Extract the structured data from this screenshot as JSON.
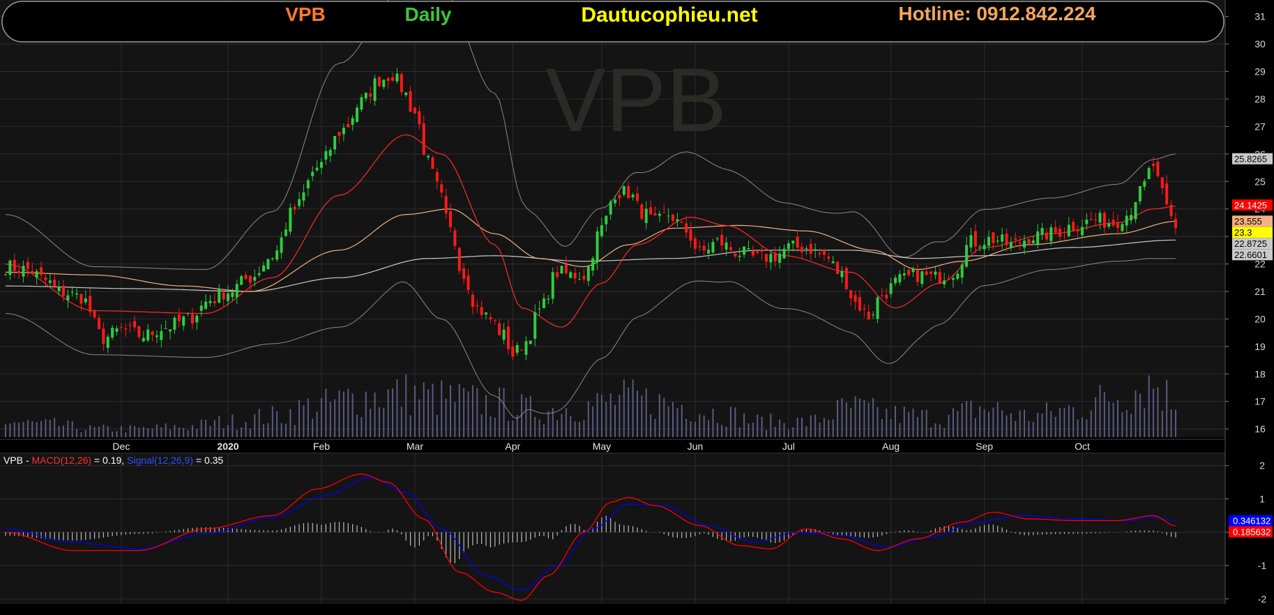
{
  "header": {
    "symbol": "VPB",
    "interval": "Daily",
    "site": "Dautucophieu.net",
    "hotline": "Hotline: 0912.842.224",
    "watermark": "VPB",
    "colors": {
      "symbol": "#ff7a2a",
      "interval": "#39c83a",
      "site": "#ffff00",
      "hotline": "#f5a65b"
    }
  },
  "price_axis": {
    "ticks": [
      "16",
      "17",
      "18",
      "19",
      "20",
      "21",
      "22",
      "23",
      "24",
      "25",
      "26",
      "27",
      "28",
      "29",
      "30",
      "31"
    ],
    "badges": [
      {
        "value": 25.8265,
        "text": "25.8265",
        "bg": "#c9c9c9",
        "fg": "#000000"
      },
      {
        "value": 24.1425,
        "text": "24.1425",
        "bg": "#ff0000",
        "fg": "#ffffff"
      },
      {
        "value": 23.555,
        "text": "23.555",
        "bg": "#f4b183",
        "fg": "#000000"
      },
      {
        "value": 23.3,
        "text": "23.3",
        "bg": "#ffff00",
        "fg": "#000000"
      },
      {
        "value": 22.8725,
        "text": "22.8725",
        "bg": "#c9c9c9",
        "fg": "#000000"
      },
      {
        "value": 22.6601,
        "text": "22.6601",
        "bg": "#c9c9c9",
        "fg": "#000000"
      }
    ]
  },
  "time_axis": {
    "labels": [
      {
        "text": "Dec",
        "bar": 26
      },
      {
        "text": "2020",
        "bar": 50,
        "bold": true
      },
      {
        "text": "Feb",
        "bar": 71
      },
      {
        "text": "Mar",
        "bar": 92
      },
      {
        "text": "Apr",
        "bar": 114
      },
      {
        "text": "May",
        "bar": 134
      },
      {
        "text": "Jun",
        "bar": 155
      },
      {
        "text": "Jul",
        "bar": 176
      },
      {
        "text": "Aug",
        "bar": 199
      },
      {
        "text": "Sep",
        "bar": 220
      },
      {
        "text": "Oct",
        "bar": 242
      }
    ]
  },
  "macd_panel": {
    "legend_symbol": "VPB - ",
    "macd_label": "MACD(12,26)",
    "macd_value": " = 0.19, ",
    "signal_label": "Signal(12,26,9)",
    "signal_value": " = 0.35",
    "ticks": [
      "-2",
      "-1",
      "0",
      "1",
      "2"
    ],
    "badges": [
      {
        "value": 0.3461,
        "text": "0.346132",
        "bg": "#0000ff",
        "fg": "#ffffff"
      },
      {
        "value": 0.1856,
        "text": "0.185632",
        "bg": "#ff0000",
        "fg": "#ffffff"
      }
    ]
  },
  "chart_data": {
    "type": "candlestick",
    "symbol": "VPB",
    "interval": "Daily",
    "price_range": [
      15.7,
      31.6
    ],
    "macd_range": [
      -2.15,
      2.35
    ],
    "colors": {
      "up": "#2ecc40",
      "down": "#ff1a1a",
      "volume": "#5a5a82",
      "ma_fast": "#ff2a2a",
      "ma_mid": "#f4b183",
      "ma_slow": "#c8c8c8",
      "bollinger": "#8a8a8a",
      "macd": "#ff0000",
      "signal": "#0000ff",
      "histogram": "#bdbdbd"
    },
    "close_anchors": [
      [
        0,
        21.9
      ],
      [
        5,
        21.8
      ],
      [
        9,
        21.4
      ],
      [
        12,
        21.0
      ],
      [
        17,
        20.8
      ],
      [
        22,
        19.3
      ],
      [
        26,
        19.6
      ],
      [
        31,
        19.4
      ],
      [
        36,
        19.7
      ],
      [
        41,
        20.0
      ],
      [
        46,
        20.7
      ],
      [
        50,
        21.0
      ],
      [
        55,
        21.5
      ],
      [
        60,
        22.3
      ],
      [
        65,
        24.0
      ],
      [
        70,
        25.5
      ],
      [
        76,
        26.9
      ],
      [
        80,
        27.9
      ],
      [
        84,
        28.7
      ],
      [
        87,
        28.9
      ],
      [
        89,
        28.4
      ],
      [
        92,
        27.5
      ],
      [
        95,
        25.7
      ],
      [
        97,
        24.8
      ],
      [
        100,
        23.2
      ],
      [
        103,
        21.6
      ],
      [
        106,
        20.4
      ],
      [
        109,
        20.0
      ],
      [
        112,
        19.4
      ],
      [
        114,
        18.7
      ],
      [
        117,
        19.2
      ],
      [
        120,
        20.3
      ],
      [
        124,
        21.7
      ],
      [
        127,
        21.6
      ],
      [
        130,
        21.6
      ],
      [
        134,
        23.3
      ],
      [
        137,
        24.6
      ],
      [
        140,
        24.6
      ],
      [
        143,
        23.9
      ],
      [
        146,
        23.5
      ],
      [
        149,
        23.8
      ],
      [
        153,
        23.2
      ],
      [
        156,
        22.4
      ],
      [
        160,
        22.8
      ],
      [
        165,
        22.4
      ],
      [
        169,
        22.2
      ],
      [
        173,
        22.3
      ],
      [
        176,
        22.6
      ],
      [
        180,
        22.6
      ],
      [
        184,
        22.3
      ],
      [
        188,
        21.6
      ],
      [
        191,
        20.6
      ],
      [
        194,
        20.1
      ],
      [
        197,
        20.9
      ],
      [
        201,
        21.4
      ],
      [
        205,
        21.6
      ],
      [
        209,
        21.5
      ],
      [
        213,
        21.7
      ],
      [
        217,
        22.8
      ],
      [
        222,
        22.9
      ],
      [
        226,
        22.7
      ],
      [
        231,
        23.0
      ],
      [
        235,
        23.1
      ],
      [
        240,
        23.4
      ],
      [
        245,
        23.6
      ],
      [
        249,
        23.5
      ],
      [
        252,
        23.8
      ],
      [
        255,
        24.6
      ],
      [
        258,
        25.6
      ],
      [
        259,
        25.0
      ],
      [
        261,
        24.0
      ],
      [
        263,
        23.3
      ]
    ],
    "ma_fast_anchors": [
      [
        0,
        22.0
      ],
      [
        20,
        20.3
      ],
      [
        45,
        20.2
      ],
      [
        60,
        21.5
      ],
      [
        75,
        24.5
      ],
      [
        90,
        26.7
      ],
      [
        98,
        26.0
      ],
      [
        110,
        22.7
      ],
      [
        116,
        20.4
      ],
      [
        125,
        19.7
      ],
      [
        134,
        21.3
      ],
      [
        142,
        22.7
      ],
      [
        154,
        23.7
      ],
      [
        162,
        23.4
      ],
      [
        175,
        22.3
      ],
      [
        190,
        21.7
      ],
      [
        200,
        20.4
      ],
      [
        210,
        21.3
      ],
      [
        220,
        22.6
      ],
      [
        235,
        23.1
      ],
      [
        250,
        23.5
      ],
      [
        258,
        24.0
      ],
      [
        263,
        24.1
      ]
    ],
    "ma_mid_anchors": [
      [
        0,
        21.7
      ],
      [
        20,
        21.6
      ],
      [
        40,
        21.2
      ],
      [
        55,
        21.0
      ],
      [
        75,
        22.5
      ],
      [
        90,
        23.8
      ],
      [
        100,
        24.0
      ],
      [
        110,
        23.1
      ],
      [
        120,
        22.2
      ],
      [
        130,
        21.9
      ],
      [
        140,
        22.7
      ],
      [
        150,
        23.3
      ],
      [
        165,
        23.4
      ],
      [
        180,
        23.2
      ],
      [
        195,
        22.5
      ],
      [
        205,
        21.8
      ],
      [
        215,
        22.1
      ],
      [
        230,
        22.7
      ],
      [
        250,
        23.1
      ],
      [
        263,
        23.55
      ]
    ],
    "ma_slow_anchors": [
      [
        0,
        21.2
      ],
      [
        30,
        21.1
      ],
      [
        55,
        21.0
      ],
      [
        75,
        21.5
      ],
      [
        95,
        22.2
      ],
      [
        110,
        22.3
      ],
      [
        130,
        22.1
      ],
      [
        150,
        22.2
      ],
      [
        170,
        22.5
      ],
      [
        190,
        22.5
      ],
      [
        205,
        22.2
      ],
      [
        220,
        22.3
      ],
      [
        240,
        22.6
      ],
      [
        263,
        22.87
      ]
    ],
    "bb_width_anchors": [
      [
        0,
        1.8
      ],
      [
        20,
        1.6
      ],
      [
        45,
        1.6
      ],
      [
        60,
        2.4
      ],
      [
        75,
        4.8
      ],
      [
        88,
        5.3
      ],
      [
        98,
        6.0
      ],
      [
        110,
        5.5
      ],
      [
        118,
        3.6
      ],
      [
        128,
        2.8
      ],
      [
        138,
        2.7
      ],
      [
        148,
        2.5
      ],
      [
        165,
        2.0
      ],
      [
        180,
        1.9
      ],
      [
        195,
        2.3
      ],
      [
        205,
        1.6
      ],
      [
        215,
        1.4
      ],
      [
        235,
        1.3
      ],
      [
        250,
        1.4
      ],
      [
        258,
        1.8
      ],
      [
        263,
        1.9
      ]
    ],
    "volume_anchors": [
      [
        0,
        22
      ],
      [
        10,
        18
      ],
      [
        20,
        12
      ],
      [
        30,
        12
      ],
      [
        40,
        15
      ],
      [
        50,
        22
      ],
      [
        60,
        30
      ],
      [
        70,
        45
      ],
      [
        80,
        58
      ],
      [
        90,
        62
      ],
      [
        100,
        55
      ],
      [
        110,
        48
      ],
      [
        120,
        38
      ],
      [
        130,
        45
      ],
      [
        140,
        55
      ],
      [
        150,
        48
      ],
      [
        160,
        35
      ],
      [
        170,
        22
      ],
      [
        180,
        22
      ],
      [
        190,
        42
      ],
      [
        200,
        32
      ],
      [
        210,
        28
      ],
      [
        220,
        42
      ],
      [
        230,
        30
      ],
      [
        240,
        40
      ],
      [
        250,
        60
      ],
      [
        258,
        78
      ],
      [
        263,
        50
      ]
    ],
    "macd_anchors": [
      [
        0,
        0.0
      ],
      [
        15,
        -0.55
      ],
      [
        30,
        -0.55
      ],
      [
        45,
        0.1
      ],
      [
        60,
        0.5
      ],
      [
        70,
        1.3
      ],
      [
        80,
        1.75
      ],
      [
        86,
        1.5
      ],
      [
        94,
        0.4
      ],
      [
        102,
        -1.2
      ],
      [
        110,
        -1.8
      ],
      [
        116,
        -2.05
      ],
      [
        122,
        -1.3
      ],
      [
        130,
        0.0
      ],
      [
        136,
        0.9
      ],
      [
        140,
        1.05
      ],
      [
        146,
        0.8
      ],
      [
        156,
        0.2
      ],
      [
        165,
        -0.4
      ],
      [
        172,
        -0.5
      ],
      [
        180,
        0.1
      ],
      [
        188,
        -0.2
      ],
      [
        196,
        -0.55
      ],
      [
        205,
        -0.2
      ],
      [
        215,
        0.3
      ],
      [
        222,
        0.6
      ],
      [
        230,
        0.4
      ],
      [
        240,
        0.35
      ],
      [
        250,
        0.35
      ],
      [
        258,
        0.5
      ],
      [
        263,
        0.19
      ]
    ],
    "signal_anchors": [
      [
        0,
        0.1
      ],
      [
        15,
        -0.3
      ],
      [
        30,
        -0.5
      ],
      [
        45,
        -0.05
      ],
      [
        60,
        0.45
      ],
      [
        72,
        1.1
      ],
      [
        82,
        1.65
      ],
      [
        90,
        1.2
      ],
      [
        98,
        0.1
      ],
      [
        108,
        -1.3
      ],
      [
        116,
        -1.75
      ],
      [
        124,
        -1.0
      ],
      [
        132,
        0.1
      ],
      [
        140,
        0.85
      ],
      [
        148,
        0.8
      ],
      [
        158,
        0.2
      ],
      [
        168,
        -0.3
      ],
      [
        178,
        0.0
      ],
      [
        188,
        -0.1
      ],
      [
        198,
        -0.45
      ],
      [
        208,
        -0.15
      ],
      [
        218,
        0.3
      ],
      [
        228,
        0.5
      ],
      [
        240,
        0.4
      ],
      [
        252,
        0.35
      ],
      [
        258,
        0.45
      ],
      [
        263,
        0.35
      ]
    ]
  }
}
